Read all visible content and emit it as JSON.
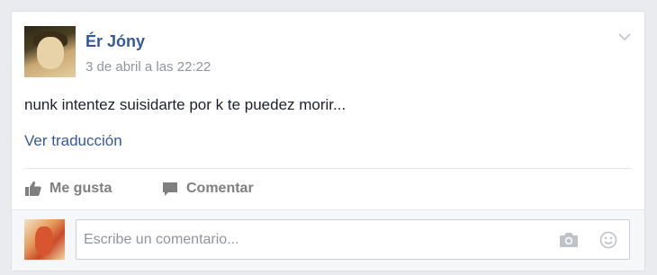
{
  "post": {
    "author": "Ér Jóny",
    "timestamp": "3 de abril a las 22:22",
    "text": "nunk intentez suisidarte por k te puedez morir...",
    "translate_link": "Ver traducción"
  },
  "actions": {
    "like_label": "Me gusta",
    "comment_label": "Comentar"
  },
  "comment_box": {
    "placeholder": "Escribe un comentario..."
  },
  "icons": {
    "menu": "chevron-down-icon",
    "like": "thumbs-up-icon",
    "comment": "speech-bubble-icon",
    "camera": "camera-icon",
    "emoji": "smiley-icon"
  },
  "colors": {
    "link": "#365899",
    "muted": "#90949c",
    "action": "#7f7f7f"
  }
}
